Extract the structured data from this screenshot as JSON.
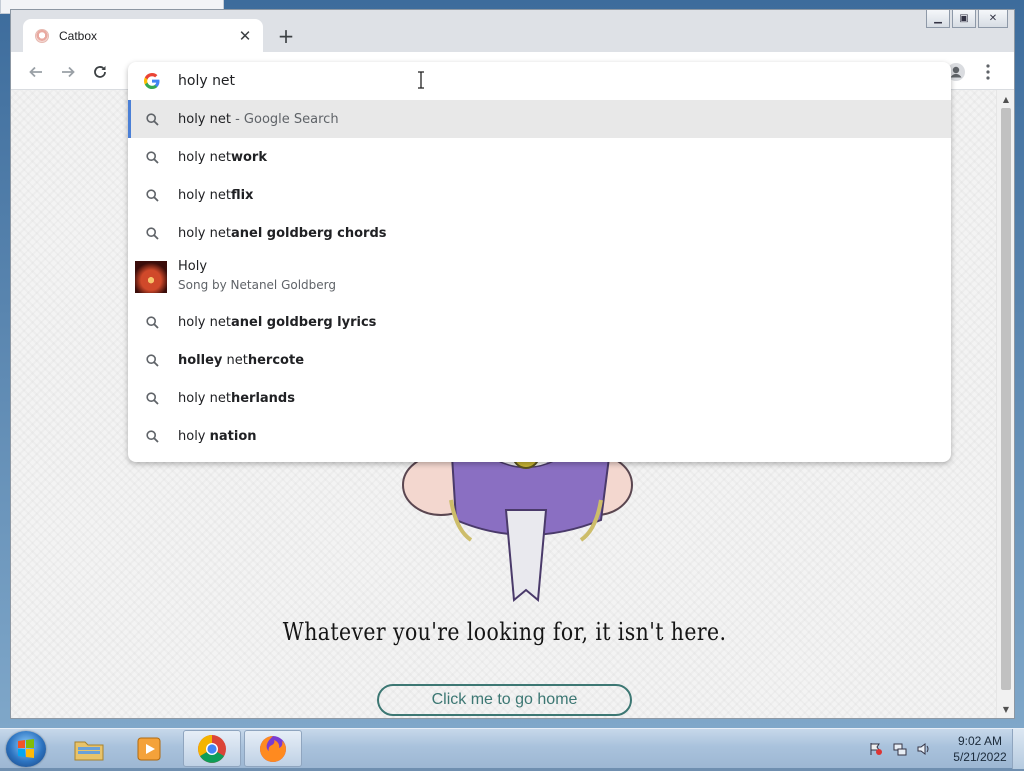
{
  "browser": {
    "tab_title": "Catbox",
    "tab_close": "✕",
    "new_tab": "+"
  },
  "omnibox": {
    "value": "holy net",
    "suggestions": [
      {
        "prefix": "holy net",
        "bold": "",
        "desc": " - Google Search",
        "selected": true
      },
      {
        "prefix": "holy net",
        "bold": "work",
        "desc": ""
      },
      {
        "prefix": "holy net",
        "bold": "flix",
        "desc": ""
      },
      {
        "prefix": "holy net",
        "bold": "anel goldberg chords",
        "desc": ""
      },
      {
        "entity": true,
        "title": "Holy",
        "subtitle": "Song by Netanel Goldberg"
      },
      {
        "prefix": "holy net",
        "bold": "anel goldberg lyrics",
        "desc": ""
      },
      {
        "prefix_bold": "holley",
        "plain": " net",
        "bold": "hercote"
      },
      {
        "prefix": "holy net",
        "bold": "herlands",
        "desc": ""
      },
      {
        "prefix": "holy ",
        "bold": "nation",
        "desc": ""
      }
    ]
  },
  "page": {
    "tagline": "Whatever you're looking for, it isn't here.",
    "home_button": "Click me to go home"
  },
  "taskbar": {
    "time": "9:02 AM",
    "date": "5/21/2022"
  },
  "colors": {
    "accent": "#4a7fd6",
    "home_button": "#3c7773"
  }
}
